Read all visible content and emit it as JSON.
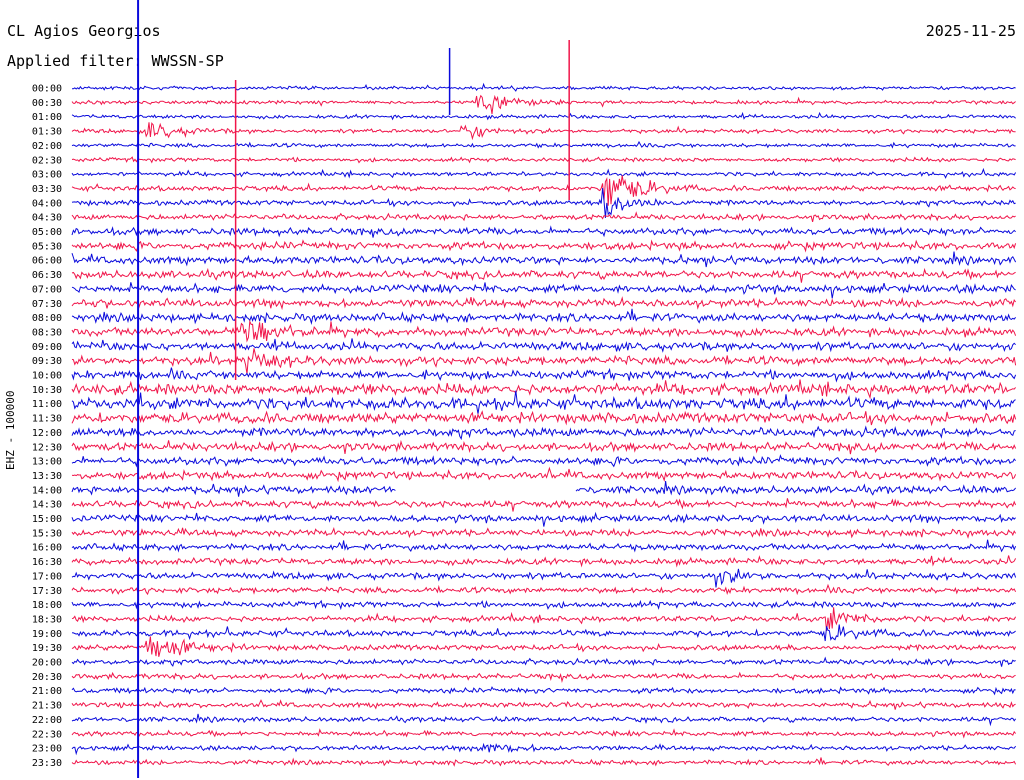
{
  "header": {
    "station": "CL Agios Georgios",
    "filter_prefix": "Applied filter:",
    "filter_name": "WWSSN-SP",
    "date": "2025-11-25"
  },
  "channel_label": "EHZ - 100000",
  "colors": {
    "trace_even": "#0a0adc",
    "trace_odd": "#f0154a",
    "text": "#000000",
    "background": "#ffffff"
  },
  "chart_data": {
    "type": "line",
    "subtype": "helicorder",
    "rows": [
      {
        "label": "00:00",
        "amplitude": 0.3
      },
      {
        "label": "00:30",
        "amplitude": 0.3
      },
      {
        "label": "01:00",
        "amplitude": 0.32
      },
      {
        "label": "01:30",
        "amplitude": 0.34
      },
      {
        "label": "02:00",
        "amplitude": 0.34
      },
      {
        "label": "02:30",
        "amplitude": 0.34
      },
      {
        "label": "03:00",
        "amplitude": 0.36
      },
      {
        "label": "03:30",
        "amplitude": 0.45
      },
      {
        "label": "04:00",
        "amplitude": 0.45
      },
      {
        "label": "04:30",
        "amplitude": 0.48
      },
      {
        "label": "05:00",
        "amplitude": 0.6
      },
      {
        "label": "05:30",
        "amplitude": 0.65
      },
      {
        "label": "06:00",
        "amplitude": 0.65
      },
      {
        "label": "06:30",
        "amplitude": 0.68
      },
      {
        "label": "07:00",
        "amplitude": 0.7
      },
      {
        "label": "07:30",
        "amplitude": 0.7
      },
      {
        "label": "08:00",
        "amplitude": 0.72
      },
      {
        "label": "08:30",
        "amplitude": 0.72
      },
      {
        "label": "09:00",
        "amplitude": 0.72
      },
      {
        "label": "09:30",
        "amplitude": 0.74
      },
      {
        "label": "10:00",
        "amplitude": 0.74
      },
      {
        "label": "10:30",
        "amplitude": 0.95
      },
      {
        "label": "11:00",
        "amplitude": 1.0
      },
      {
        "label": "11:30",
        "amplitude": 0.9
      },
      {
        "label": "12:00",
        "amplitude": 0.75
      },
      {
        "label": "12:30",
        "amplitude": 0.72
      },
      {
        "label": "13:00",
        "amplitude": 0.68
      },
      {
        "label": "13:30",
        "amplitude": 0.66
      },
      {
        "label": "14:00",
        "amplitude": 0.66
      },
      {
        "label": "14:30",
        "amplitude": 0.62
      },
      {
        "label": "15:00",
        "amplitude": 0.6
      },
      {
        "label": "15:30",
        "amplitude": 0.58
      },
      {
        "label": "16:00",
        "amplitude": 0.55
      },
      {
        "label": "16:30",
        "amplitude": 0.55
      },
      {
        "label": "17:00",
        "amplitude": 0.55
      },
      {
        "label": "17:30",
        "amplitude": 0.5
      },
      {
        "label": "18:00",
        "amplitude": 0.5
      },
      {
        "label": "18:30",
        "amplitude": 0.5
      },
      {
        "label": "19:00",
        "amplitude": 0.52
      },
      {
        "label": "19:30",
        "amplitude": 0.48
      },
      {
        "label": "20:00",
        "amplitude": 0.46
      },
      {
        "label": "20:30",
        "amplitude": 0.46
      },
      {
        "label": "21:00",
        "amplitude": 0.44
      },
      {
        "label": "21:30",
        "amplitude": 0.44
      },
      {
        "label": "22:00",
        "amplitude": 0.42
      },
      {
        "label": "22:30",
        "amplitude": 0.42
      },
      {
        "label": "23:00",
        "amplitude": 0.4
      },
      {
        "label": "23:30",
        "amplitude": 0.4
      }
    ],
    "events": [
      {
        "row": "01:30",
        "minute": 2.5,
        "peak": 1.6
      },
      {
        "row": "01:30",
        "minute": 12.5,
        "peak": 1.2
      },
      {
        "row": "00:30",
        "minute": 13.0,
        "peak": 3.0
      },
      {
        "row": "03:30",
        "minute": 17.0,
        "peak": 4.5
      },
      {
        "row": "04:00",
        "minute": 17.0,
        "peak": 3.0
      },
      {
        "row": "08:30",
        "minute": 5.5,
        "peak": 3.0
      },
      {
        "row": "09:30",
        "minute": 5.5,
        "peak": 2.0
      },
      {
        "row": "18:30",
        "minute": 24.0,
        "peak": 1.8
      },
      {
        "row": "19:00",
        "minute": 24.0,
        "peak": 1.4
      },
      {
        "row": "17:00",
        "minute": 20.5,
        "peak": 1.4
      },
      {
        "row": "23:00",
        "minute": 13.0,
        "peak": 1.4
      },
      {
        "row": "19:30",
        "minute": 2.5,
        "peak": 3.0
      }
    ],
    "gaps": [
      {
        "row": "14:00",
        "minute_start": 10.3,
        "minute_end": 16.0
      }
    ],
    "x_range_minutes": [
      0,
      30
    ],
    "grid": false
  }
}
